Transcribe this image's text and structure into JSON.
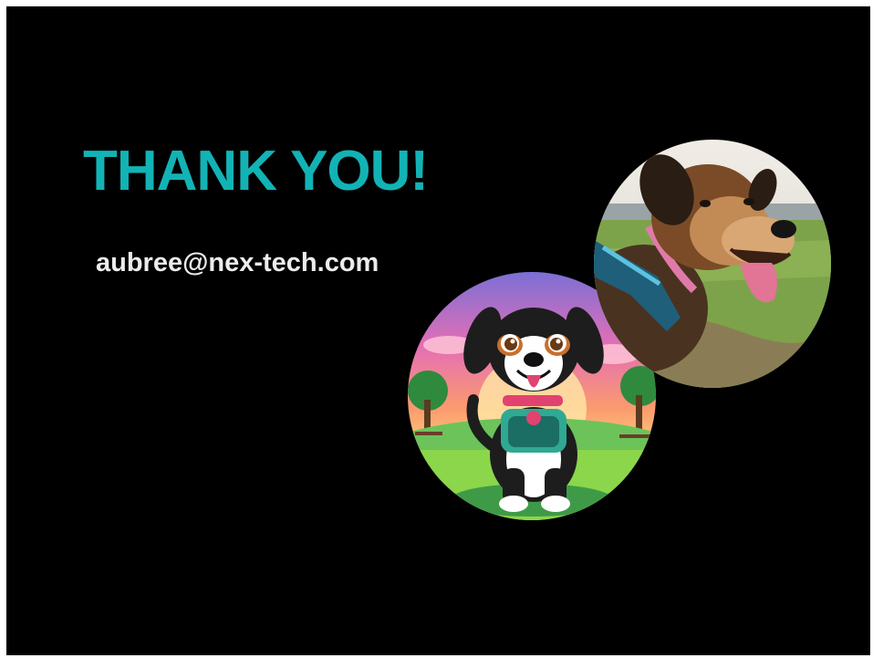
{
  "slide": {
    "title": "THANK YOU!",
    "email": "aubree@nex-tech.com",
    "accent_color": "#12b3b5",
    "background_color": "#000000"
  },
  "images": {
    "cartoon_dog": {
      "icon": "cartoon-dog-illustration"
    },
    "photo_dog": {
      "icon": "dog-photo"
    }
  }
}
